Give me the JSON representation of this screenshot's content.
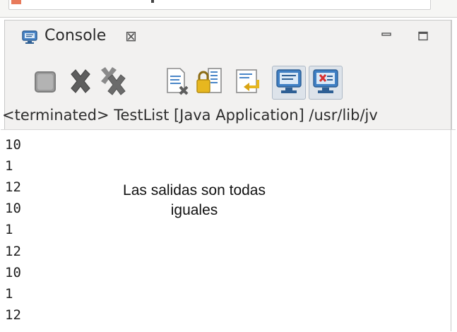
{
  "window": {
    "tab_title": "Console",
    "tab_close_glyph": "⊠"
  },
  "toolbar": {
    "buttons": [
      {
        "name": "terminate-button",
        "icon": "stop-square-icon"
      },
      {
        "name": "remove-launch-button",
        "icon": "remove-x-icon"
      },
      {
        "name": "remove-all-terminated-button",
        "icon": "remove-all-x-icon"
      },
      {
        "name": "clear-console-button",
        "icon": "clear-console-icon"
      },
      {
        "name": "scroll-lock-button",
        "icon": "scroll-lock-icon"
      },
      {
        "name": "word-wrap-button",
        "icon": "word-wrap-icon"
      },
      {
        "name": "pin-console-button",
        "icon": "pin-console-icon"
      },
      {
        "name": "display-selected-console-button",
        "icon": "display-console-icon"
      }
    ]
  },
  "status_line": "<terminated> TestList [Java Application] /usr/lib/jv",
  "output_lines": [
    "10",
    "1",
    "12",
    "10",
    "1",
    "12",
    "10",
    "1",
    "12"
  ],
  "annotation": {
    "line1": "Las salidas son todas",
    "line2": "iguales"
  },
  "colors": {
    "view_background": "#f2f1f0",
    "output_background": "#ffffff",
    "stop_gray": "#9b9b9b",
    "x_gray": "#5e5e5e",
    "icon_blue": "#3f7fc4",
    "icon_yellow": "#e7b71f"
  }
}
